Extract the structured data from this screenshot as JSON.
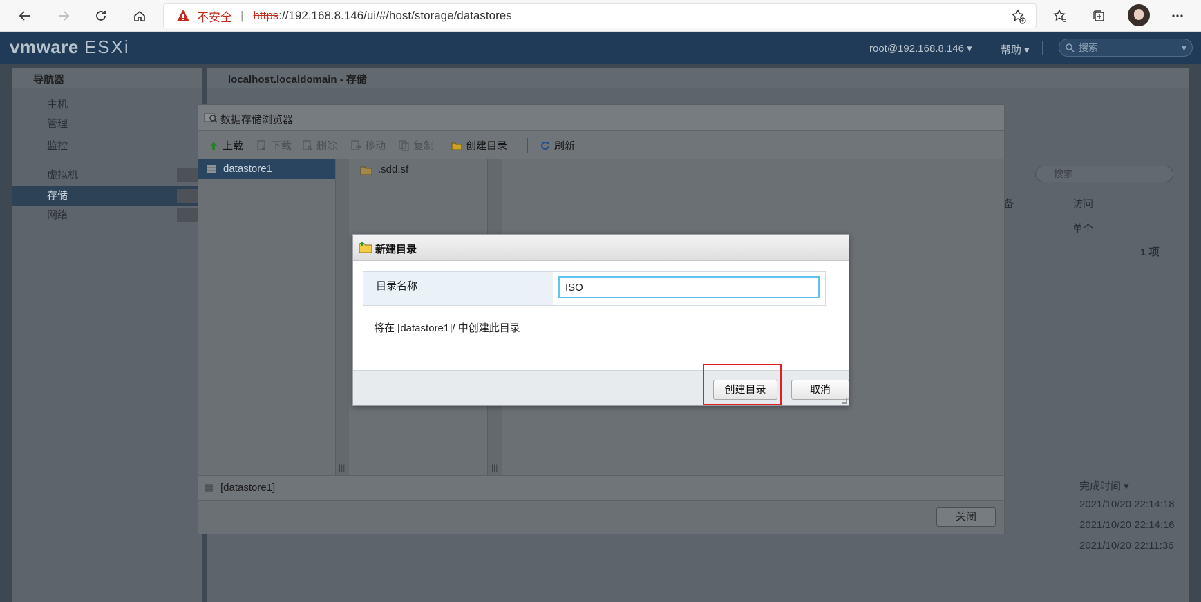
{
  "browser": {
    "insecure_label": "不安全",
    "url_protocol": "https",
    "url_rest": "://192.168.8.146/ui/#/host/storage/datastores"
  },
  "esxi": {
    "logo_vm": "vmware",
    "logo_product": "ESXi",
    "user_menu": "root@192.168.8.146 ▾",
    "help_menu": "帮助 ▾",
    "search_placeholder": "搜索",
    "navigator_title": "导航器",
    "nav_items": [
      {
        "label": "主机"
      },
      {
        "label": "管理"
      },
      {
        "label": "监控"
      },
      {
        "label": "虚拟机"
      },
      {
        "label": "存储"
      },
      {
        "label": "网络"
      }
    ],
    "main_title": "localhost.localdomain - 存储",
    "bg_search_placeholder": "搜索",
    "bg_table": {
      "col_device": "备",
      "col_access": "访问",
      "cell_device": "",
      "cell_access": "单个",
      "count": "1 项"
    },
    "bg_tasks": {
      "col_completed": "完成时间 ▾",
      "rows": [
        "2021/10/20 22:14:18",
        "2021/10/20 22:14:16",
        "2021/10/20 22:11:36"
      ]
    }
  },
  "ds_browser": {
    "title": "数据存储浏览器",
    "toolbar": {
      "upload": "上载",
      "download": "下载",
      "delete": "删除",
      "move": "移动",
      "copy": "复制",
      "mkdir": "创建目录",
      "refresh": "刷新"
    },
    "datastore": "datastore1",
    "file": ".sdd.sf",
    "path": "[datastore1]",
    "close_label": "关闭"
  },
  "dialog": {
    "title": "新建目录",
    "field_label": "目录名称",
    "field_value": "ISO",
    "note": "将在 [datastore1]/ 中创建此目录",
    "create_label": "创建目录",
    "cancel_label": "取消"
  },
  "colors": {
    "highlight": "#e02020",
    "input_focus": "#5fc3f0",
    "selected_row": "#2a4560"
  }
}
